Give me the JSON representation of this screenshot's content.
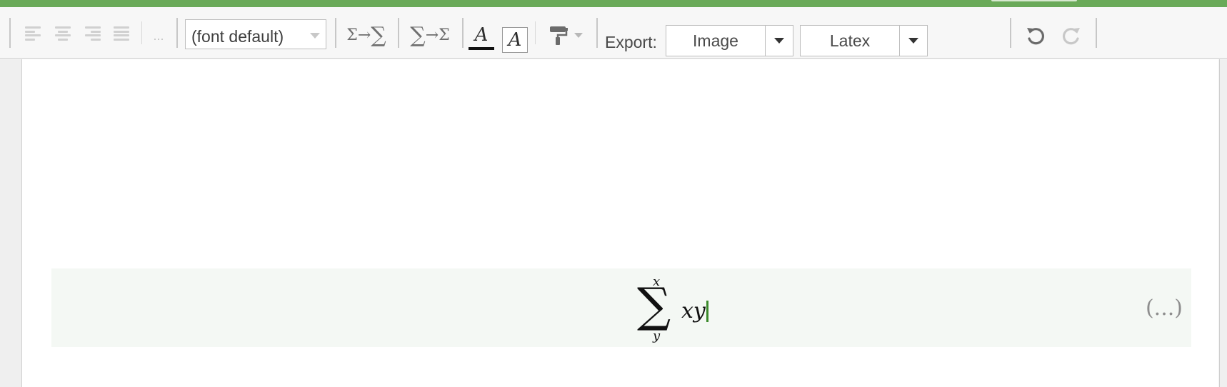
{
  "toolbar": {
    "align_buttons": [
      "align-left",
      "align-center",
      "align-right",
      "align-justify"
    ],
    "more_label": "...",
    "font_select": {
      "value": "(font default)"
    },
    "sum_style_1": {
      "from": "Σ",
      "arrow": "→",
      "to": "∑"
    },
    "sum_style_2": {
      "from": "∑",
      "arrow": "→",
      "to": "Σ"
    },
    "font_style_a": "A",
    "font_style_a_boxed": "A",
    "export": {
      "label": "Export:",
      "image_label": "Image",
      "latex_label": "Latex"
    },
    "undo_icon": "undo-icon",
    "redo_icon": "redo-icon"
  },
  "editor": {
    "equation": {
      "operator": "∑",
      "upper": "x",
      "lower": "y",
      "body": "xy"
    },
    "status": "(...)"
  },
  "colors": {
    "accent_green": "#6aaa59",
    "cursor_green": "#3b8a2b",
    "math_block_bg": "#f4f8f4"
  }
}
